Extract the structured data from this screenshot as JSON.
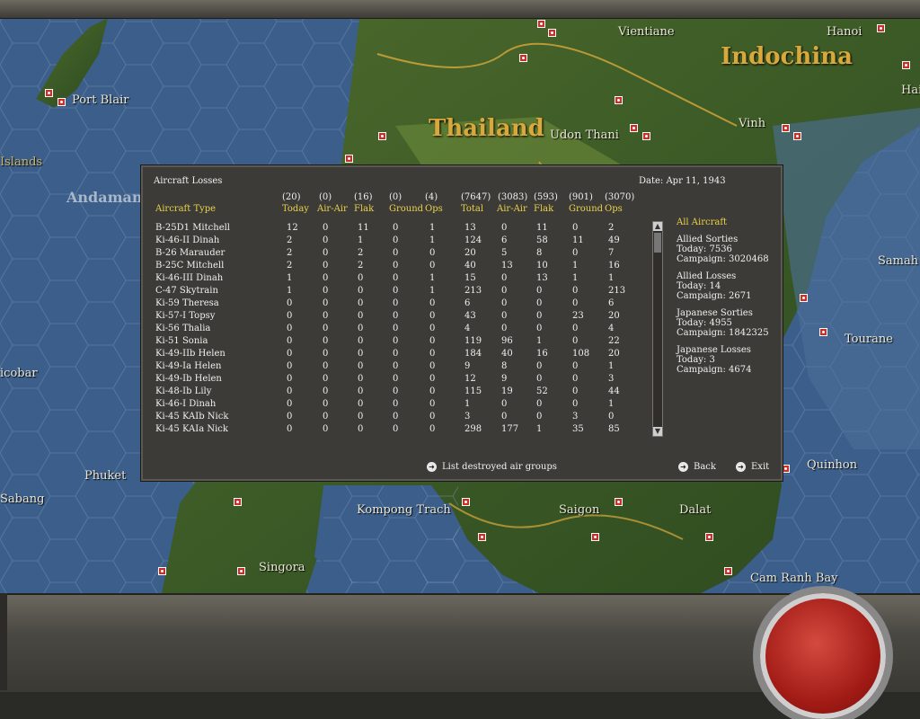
{
  "map": {
    "labels": {
      "indochina": "Indochina",
      "thailand": "Thailand",
      "vientiane": "Vientiane",
      "hanoi": "Hanoi",
      "port_blair": "Port Blair",
      "islands": "Islands",
      "andaman": "Andaman",
      "udon_thani": "Udon Thani",
      "vinh": "Vinh",
      "samah": "Samah",
      "tourane": "Tourane",
      "nicobar": "icobar",
      "phuket": "Phuket",
      "sabang": "Sabang",
      "kompong_trach": "Kompong Trach",
      "saigon": "Saigon",
      "dalat": "Dalat",
      "quinhon": "Quinhon",
      "singora": "Singora",
      "cam_ranh": "Cam Ranh Bay",
      "hai": "Hai"
    }
  },
  "panel": {
    "title": "Aircraft Losses",
    "date": "Date: Apr 11, 1943",
    "totals": [
      "(20)",
      "(0)",
      "(16)",
      "(0)",
      "(4)",
      "(7647)",
      "(3083)",
      "(593)",
      "(901)",
      "(3070)"
    ],
    "headers": {
      "type": "Aircraft Type",
      "today": "Today",
      "air_air": "Air-Air",
      "flak": "Flak",
      "ground": "Ground",
      "ops": "Ops",
      "total": "Total",
      "air_air2": "Air-Air",
      "flak2": "Flak",
      "ground2": "Ground",
      "ops2": "Ops"
    },
    "rows": [
      [
        "B-25D1 Mitchell",
        "12",
        "0",
        "11",
        "0",
        "1",
        "13",
        "0",
        "11",
        "0",
        "2"
      ],
      [
        "Ki-46-II Dinah",
        "2",
        "0",
        "1",
        "0",
        "1",
        "124",
        "6",
        "58",
        "11",
        "49"
      ],
      [
        "B-26 Marauder",
        "2",
        "0",
        "2",
        "0",
        "0",
        "20",
        "5",
        "8",
        "0",
        "7"
      ],
      [
        "B-25C Mitchell",
        "2",
        "0",
        "2",
        "0",
        "0",
        "40",
        "13",
        "10",
        "1",
        "16"
      ],
      [
        "Ki-46-III Dinah",
        "1",
        "0",
        "0",
        "0",
        "1",
        "15",
        "0",
        "13",
        "1",
        "1"
      ],
      [
        "C-47 Skytrain",
        "1",
        "0",
        "0",
        "0",
        "1",
        "213",
        "0",
        "0",
        "0",
        "213"
      ],
      [
        "Ki-59 Theresa",
        "0",
        "0",
        "0",
        "0",
        "0",
        "6",
        "0",
        "0",
        "0",
        "6"
      ],
      [
        "Ki-57-I Topsy",
        "0",
        "0",
        "0",
        "0",
        "0",
        "43",
        "0",
        "0",
        "23",
        "20"
      ],
      [
        "Ki-56 Thalia",
        "0",
        "0",
        "0",
        "0",
        "0",
        "4",
        "0",
        "0",
        "0",
        "4"
      ],
      [
        "Ki-51 Sonia",
        "0",
        "0",
        "0",
        "0",
        "0",
        "119",
        "96",
        "1",
        "0",
        "22"
      ],
      [
        "Ki-49-IIb Helen",
        "0",
        "0",
        "0",
        "0",
        "0",
        "184",
        "40",
        "16",
        "108",
        "20"
      ],
      [
        "Ki-49-Ia Helen",
        "0",
        "0",
        "0",
        "0",
        "0",
        "9",
        "8",
        "0",
        "0",
        "1"
      ],
      [
        "Ki-49-Ib Helen",
        "0",
        "0",
        "0",
        "0",
        "0",
        "12",
        "9",
        "0",
        "0",
        "3"
      ],
      [
        "Ki-48-Ib Lily",
        "0",
        "0",
        "0",
        "0",
        "0",
        "115",
        "19",
        "52",
        "0",
        "44"
      ],
      [
        "Ki-46-I Dinah",
        "0",
        "0",
        "0",
        "0",
        "0",
        "1",
        "0",
        "0",
        "0",
        "1"
      ],
      [
        "Ki-45 KAIb Nick",
        "0",
        "0",
        "0",
        "0",
        "0",
        "3",
        "0",
        "0",
        "3",
        "0"
      ],
      [
        "Ki-45 KAIa Nick",
        "0",
        "0",
        "0",
        "0",
        "0",
        "298",
        "177",
        "1",
        "35",
        "85"
      ]
    ],
    "side": {
      "all_aircraft": "All Aircraft",
      "allied_sorties": {
        "label": "Allied Sorties",
        "today": "Today:   7536",
        "campaign": "Campaign: 3020468"
      },
      "allied_losses": {
        "label": "Allied Losses",
        "today": "Today:   14",
        "campaign": "Campaign: 2671"
      },
      "japanese_sorties": {
        "label": "Japanese Sorties",
        "today": "Today:   4955",
        "campaign": "Campaign: 1842325"
      },
      "japanese_losses": {
        "label": "Japanese Losses",
        "today": "Today:   3",
        "campaign": "Campaign: 4674"
      }
    },
    "buttons": {
      "list_destroyed": "List destroyed air groups",
      "back": "Back",
      "exit": "Exit"
    }
  }
}
